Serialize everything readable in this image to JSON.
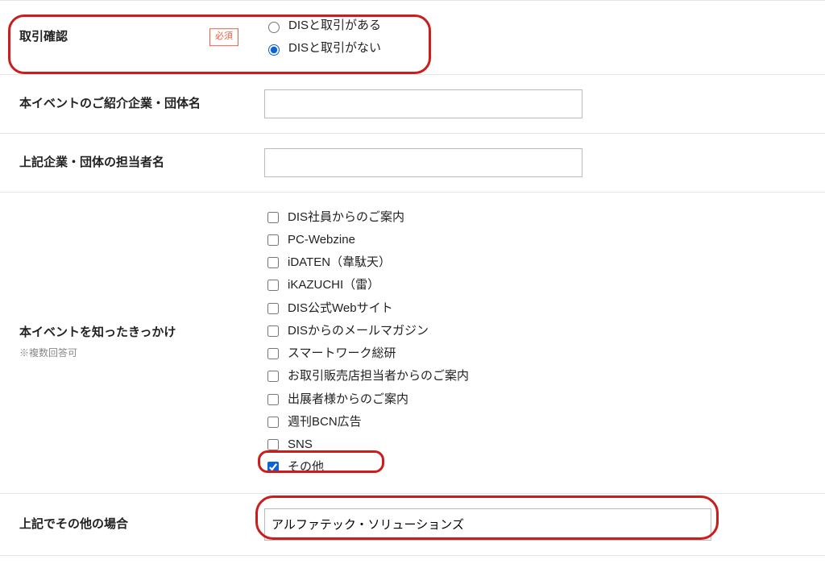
{
  "rows": {
    "transaction": {
      "label": "取引確認",
      "required_text": "必須",
      "options": [
        "DISと取引がある",
        "DISと取引がない"
      ],
      "selected_index": 1
    },
    "referrer_company": {
      "label": "本イベントのご紹介企業・団体名",
      "value": ""
    },
    "referrer_person": {
      "label": "上記企業・団体の担当者名",
      "value": ""
    },
    "trigger": {
      "label": "本イベントを知ったきっかけ",
      "note": "※複数回答可",
      "options": [
        {
          "label": "DIS社員からのご案内",
          "checked": false
        },
        {
          "label": "PC-Webzine",
          "checked": false
        },
        {
          "label": "iDATEN（韋駄天）",
          "checked": false
        },
        {
          "label": "iKAZUCHI（雷）",
          "checked": false
        },
        {
          "label": "DIS公式Webサイト",
          "checked": false
        },
        {
          "label": "DISからのメールマガジン",
          "checked": false
        },
        {
          "label": "スマートワーク総研",
          "checked": false
        },
        {
          "label": "お取引販売店担当者からのご案内",
          "checked": false
        },
        {
          "label": "出展者様からのご案内",
          "checked": false
        },
        {
          "label": "週刊BCN広告",
          "checked": false
        },
        {
          "label": "SNS",
          "checked": false
        },
        {
          "label": "その他",
          "checked": true
        }
      ]
    },
    "trigger_other": {
      "label": "上記でその他の場合",
      "value": "アルファテック・ソリューションズ"
    }
  }
}
